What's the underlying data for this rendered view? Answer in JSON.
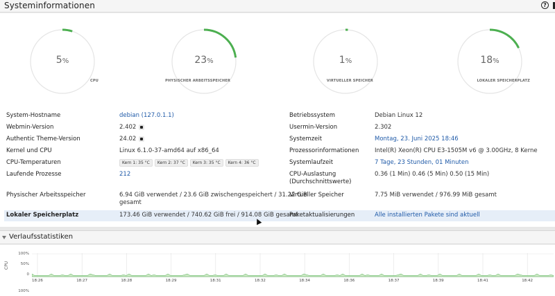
{
  "header": {
    "title": "Systeminformationen",
    "help_icon": "help-icon"
  },
  "gauges": [
    {
      "value": "5",
      "unit": "%",
      "caption": "CPU",
      "fraction": 0.05
    },
    {
      "value": "23",
      "unit": "%",
      "caption": "PHYSISCHER ARBEITSSPEICHER",
      "fraction": 0.23
    },
    {
      "value": "1",
      "unit": "%",
      "caption": "VIRTUELLER SPEICHER",
      "fraction": 0.01
    },
    {
      "value": "18",
      "unit": "%",
      "caption": "LOKALER SPEICHERPLATZ",
      "fraction": 0.18
    }
  ],
  "info": {
    "hostname_label": "System-Hostname",
    "hostname": "debian (127.0.1.1)",
    "webmin_label": "Webmin-Version",
    "webmin": "2.402",
    "theme_label": "Authentic Theme-Version",
    "theme": "24.02",
    "kernel_label": "Kernel und CPU",
    "kernel": "Linux 6.1.0-37-amd64 auf x86_64",
    "temp_label": "CPU-Temperaturen",
    "temps": [
      "Kern 1: 35 °C",
      "Kern 2: 37 °C",
      "Kern 3: 35 °C",
      "Kern 4: 36 °C"
    ],
    "proc_label": "Laufende Prozesse",
    "proc": "212",
    "mem_label": "Physischer Arbeitsspeicher",
    "mem_1": "6.94 GiB verwendet / 23.6 GiB zwischengespeichert / 31.22 GiB",
    "mem_2": "gesamt",
    "disk_label": "Lokaler Speicherplatz",
    "disk": "173.46 GiB verwendet / 740.62 GiB frei / 914.08 GiB gesamt",
    "os_label": "Betriebssystem",
    "os": "Debian Linux 12",
    "usermin_label": "Usermin-Version",
    "usermin": "2.302",
    "time_label": "Systemzeit",
    "time": "Montag, 23. Juni 2025 18:46",
    "cpuinfo_label": "Prozessorinformationen",
    "cpuinfo": "Intel(R) Xeon(R) CPU E3-1505M v6 @ 3.00GHz, 8 Kerne",
    "uptime_label": "Systemlaufzeit",
    "uptime": "7 Tage, 23 Stunden, 01 Minuten",
    "load_label_1": "CPU-Auslastung",
    "load_label_2": "(Durchschnittswerte)",
    "load": "0.36 (1 Min) 0.46 (5 Min) 0.50 (15 Min)",
    "vmem_label": "Virtueller Speicher",
    "vmem": "7.75 MiB verwendet / 976.99 MiB gesamt",
    "pkg_label": "Paketaktualisierungen",
    "pkg": "Alle installierten Pakete sind aktuell"
  },
  "history": {
    "title": "Verlaufsstatistiken",
    "cpu_label": "CPU",
    "y_ticks": [
      "100%",
      "50%",
      "0"
    ],
    "y_tick_2": "100%",
    "x_ticks": [
      "18:26",
      "18:27",
      "18:28",
      "18:29",
      "18:31",
      "18:32",
      "18:34",
      "18:36",
      "18:37",
      "18:39",
      "18:41",
      "18:42",
      "18:44"
    ],
    "accent": "#4caf50"
  }
}
